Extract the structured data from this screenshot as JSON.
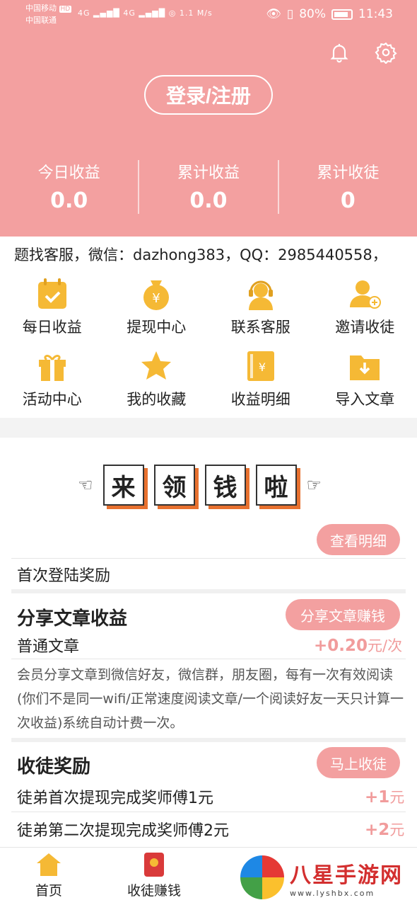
{
  "status_bar": {
    "carrier1": "中国移动",
    "carrier1_badge": "HD",
    "carrier2": "中国联通",
    "net_speed": "1.1 M/s",
    "battery": "80%",
    "time": "11:43"
  },
  "header": {
    "login_label": "登录/注册",
    "stats": [
      {
        "label": "今日收益",
        "value": "0.0"
      },
      {
        "label": "累计收益",
        "value": "0.0"
      },
      {
        "label": "累计收徒",
        "value": "0"
      }
    ]
  },
  "marquee": "题找客服，微信：dazhong383，QQ：2985440558，",
  "menu": [
    {
      "label": "每日收益",
      "icon": "calendar-check-icon"
    },
    {
      "label": "提现中心",
      "icon": "money-bag-icon"
    },
    {
      "label": "联系客服",
      "icon": "headset-icon"
    },
    {
      "label": "邀请收徒",
      "icon": "add-user-icon"
    },
    {
      "label": "活动中心",
      "icon": "gift-icon"
    },
    {
      "label": "我的收藏",
      "icon": "star-icon"
    },
    {
      "label": "收益明细",
      "icon": "ticket-icon"
    },
    {
      "label": "导入文章",
      "icon": "import-folder-icon"
    }
  ],
  "banner": {
    "chars": [
      "来",
      "领",
      "钱",
      "啦"
    ]
  },
  "rewards": {
    "view_details": "查看明细",
    "first_login": "首次登陆奖励",
    "share_title": "分享文章收益",
    "share_button": "分享文章赚钱",
    "normal_article": "普通文章",
    "normal_price_amount": "+0.20",
    "normal_price_unit": "元/次",
    "share_desc": "会员分享文章到微信好友，微信群，朋友圈，每有一次有效阅读(你们不是同一wifi/正常速度阅读文章/一个阅读好友一天只计算一次收益)系统自动计费一次。",
    "apprentice_title": "收徒奖励",
    "apprentice_button": "马上收徒",
    "rule1": "徒弟首次提现完成奖师傅1元",
    "rule1_amount": "+1",
    "rule1_unit": "元",
    "rule2": "徒弟第二次提现完成奖师傅2元",
    "rule2_amount": "+2",
    "rule2_unit": "元"
  },
  "tabbar": {
    "home": "首页",
    "earn": "收徒赚钱"
  },
  "watermark": {
    "title": "八星手游网",
    "url": "www.lyshbx.com"
  },
  "colors": {
    "accent": "#f3a0a0",
    "icon_gold": "#f5b935",
    "stamp_shadow": "#e8712f"
  }
}
